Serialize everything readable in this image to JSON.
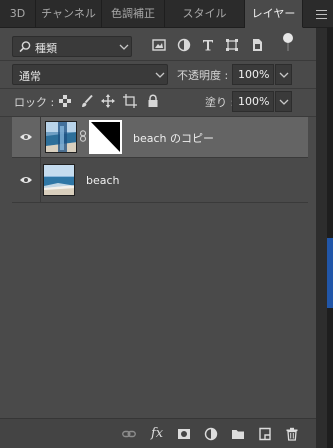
{
  "tabs": [
    {
      "label": "3D"
    },
    {
      "label": "チャンネル"
    },
    {
      "label": "色調補正"
    },
    {
      "label": "スタイル"
    },
    {
      "label": "レイヤー"
    }
  ],
  "active_tab": "レイヤー",
  "filter": {
    "kind_label": "種類"
  },
  "blend_mode": {
    "value": "通常"
  },
  "opacity": {
    "label": "不透明度 :",
    "value": "100%"
  },
  "lock": {
    "label": "ロック :"
  },
  "fill": {
    "label": "塗り :",
    "value": "100%"
  },
  "layers": [
    {
      "name": "beach のコピー",
      "selected": true,
      "visible": true,
      "has_mask": true
    },
    {
      "name": "beach",
      "selected": false,
      "visible": true,
      "has_mask": false
    }
  ],
  "footer_icons": [
    "link-layers-icon",
    "fx-icon",
    "add-mask-icon",
    "adjustment-layer-icon",
    "new-group-icon",
    "new-layer-icon",
    "trash-icon"
  ],
  "footer": {
    "fx_label": "fx"
  },
  "colors": {
    "panel_bg": "#4a4a4a",
    "tab_bar_bg": "#2b2b2b",
    "selected_row": "#646464",
    "field_bg": "#3a3a3a"
  }
}
